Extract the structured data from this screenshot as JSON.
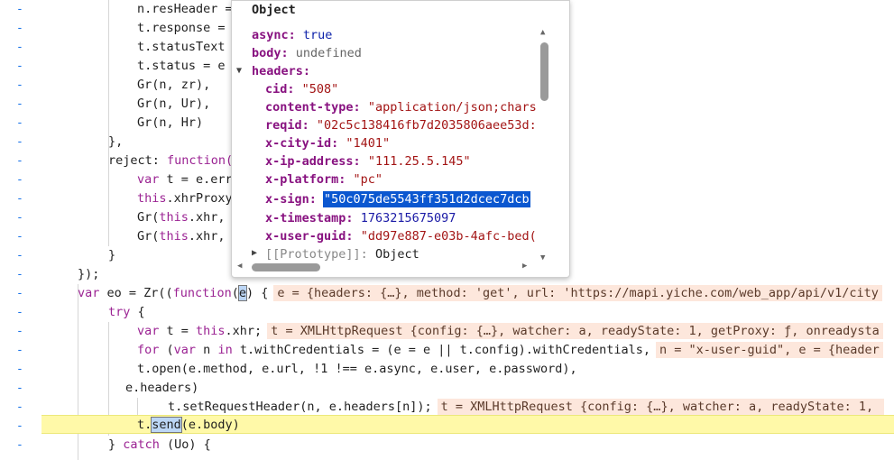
{
  "gutter": {
    "mark": "-"
  },
  "code": {
    "l0": "n.resHeader = ",
    "l1": "t.response = ",
    "l2": "t.statusText",
    "l3": "t.status = e",
    "l4": "Gr(n, zr),",
    "l5": "Gr(n, Ur),",
    "l6": "Gr(n, Hr)",
    "l7": "},",
    "l8a": "reject: ",
    "l8b": "function(",
    "l9a": "var",
    "l9b": " t = e.err",
    "l10a": "this",
    "l10b": ".xhrProxy",
    "l11a": "Gr(",
    "l11b": "this",
    "l11c": ".xhr,",
    "l12a": "Gr(",
    "l12b": "this",
    "l12c": ".xhr,",
    "l13": "}",
    "l14": "});",
    "l15a": "var",
    "l15b": " eo = Zr((",
    "l15c": "function",
    "l15d": "(",
    "l15e": "e",
    "l15f": ") {",
    "l15v": "e = {headers: {…}, method: 'get', url: 'https://mapi.yiche.com/web_app/api/v1/city",
    "l16a": "try",
    "l16b": " {",
    "l17a": "var",
    "l17b": " t = ",
    "l17c": "this",
    "l17d": ".xhr;",
    "l17v": "t = XMLHttpRequest {config: {…}, watcher: a, readyState: 1, getProxy: ƒ, onreadysta",
    "l18a": "for",
    "l18b": " (",
    "l18c": "var",
    "l18d": " n ",
    "l18e": "in",
    "l18f": " t.withCredentials = (e = e || t.config).withCredentials,",
    "l18v": "n = \"x-user-guid\", e = {header",
    "l19": "t.open(e.method, e.url, !1 !== e.async, e.user, e.password),",
    "l20": "e.headers)",
    "l21": "t.setRequestHeader(n, e.headers[n]);",
    "l21v": "t = XMLHttpRequest {config: {…}, watcher: a, readyState: 1, ",
    "l22a": "t.",
    "l22b": "send",
    "l22c": "(e.body)",
    "l23a": "} ",
    "l23b": "catch",
    "l23c": " (Uo) {"
  },
  "popover": {
    "title": "Object",
    "async_key": "async:",
    "async_val": "true",
    "body_key": "body:",
    "body_val": "undefined",
    "headers_key": "headers:",
    "cid_key": "cid:",
    "cid_val": "\"508\"",
    "ctype_key": "content-type:",
    "ctype_val": "\"application/json;chars",
    "reqid_key": "reqid:",
    "reqid_val": "\"02c5c138416fb7d2035806aee53d:",
    "cityid_key": "x-city-id:",
    "cityid_val": "\"1401\"",
    "ip_key": "x-ip-address:",
    "ip_val": "\"111.25.5.145\"",
    "platform_key": "x-platform:",
    "platform_val": "\"pc\"",
    "sign_key": "x-sign:",
    "sign_val": "\"50c075de5543ff351d2dcec7dcb",
    "ts_key": "x-timestamp:",
    "ts_val": "1763215675097",
    "guid_key": "x-user-guid:",
    "guid_val": "\"dd97e887-e03b-4afc-bed(",
    "proto_key": "[[Prototype]]:",
    "proto_val": "Object"
  }
}
